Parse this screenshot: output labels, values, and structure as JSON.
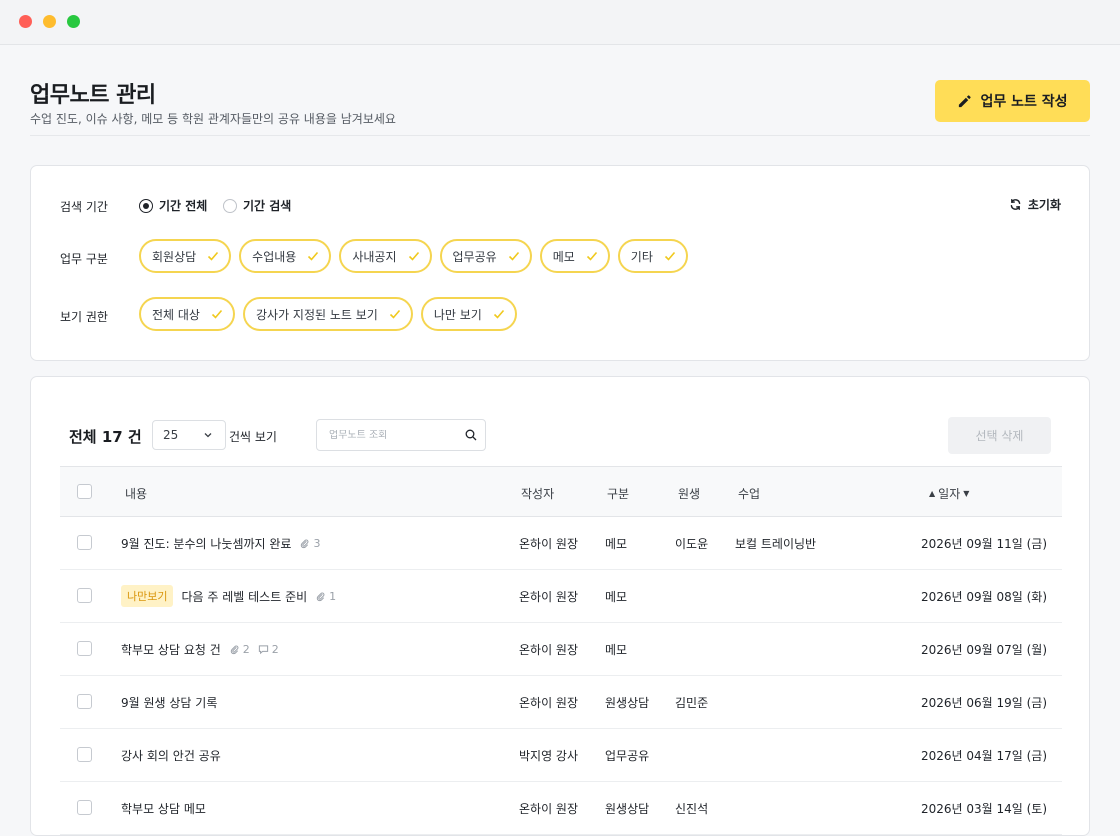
{
  "header": {
    "title": "업무노트 관리",
    "subtitle": "수업 진도, 이슈 사항, 메모 등 학원 관계자들만의 공유 내용을 남겨보세요",
    "write_button": "업무 노트 작성"
  },
  "filters": {
    "period_label": "검색 기간",
    "period_all": "기간 전체",
    "period_search": "기간 검색",
    "reset_label": "초기화",
    "category_label": "업무 구분",
    "categories": [
      "회원상담",
      "수업내용",
      "사내공지",
      "업무공유",
      "메모",
      "기타"
    ],
    "permission_label": "보기 권한",
    "permissions": [
      "전체 대상",
      "강사가 지정된 노트 보기",
      "나만 보기"
    ]
  },
  "list": {
    "total": "전체 17 건",
    "page_size": "25",
    "per_page_label": "건씩 보기",
    "search_placeholder": "업무노트 조회",
    "delete_button": "선택 삭제",
    "columns": {
      "content": "내용",
      "author": "작성자",
      "category": "구분",
      "student": "원생",
      "class": "수업",
      "date": "일자"
    },
    "rows": [
      {
        "tag": "",
        "title": "9월 진도: 분수의 나눗셈까지 완료",
        "attachments": "3",
        "comments": "",
        "author": "온하이 원장",
        "category": "메모",
        "student": "이도윤",
        "class": "보컬 트레이닝반",
        "date": "2026년 09월 11일 (금)"
      },
      {
        "tag": "나만보기",
        "title": "다음 주 레벨 테스트 준비",
        "attachments": "1",
        "comments": "",
        "author": "온하이 원장",
        "category": "메모",
        "student": "",
        "class": "",
        "date": "2026년 09월 08일 (화)"
      },
      {
        "tag": "",
        "title": "학부모 상담 요청 건",
        "attachments": "2",
        "comments": "2",
        "author": "온하이 원장",
        "category": "메모",
        "student": "",
        "class": "",
        "date": "2026년 09월 07일 (월)"
      },
      {
        "tag": "",
        "title": "9월 원생 상담 기록",
        "attachments": "",
        "comments": "",
        "author": "온하이 원장",
        "category": "원생상담",
        "student": "김민준",
        "class": "",
        "date": "2026년 06월 19일 (금)"
      },
      {
        "tag": "",
        "title": "강사 회의 안건 공유",
        "attachments": "",
        "comments": "",
        "author": "박지영 강사",
        "category": "업무공유",
        "student": "",
        "class": "",
        "date": "2026년 04월 17일 (금)"
      },
      {
        "tag": "",
        "title": "학부모 상담 메모",
        "attachments": "",
        "comments": "",
        "author": "온하이 원장",
        "category": "원생상담",
        "student": "신진석",
        "class": "",
        "date": "2026년 03월 14일 (토)"
      }
    ]
  },
  "colors": {
    "accent": "#ffdd57",
    "chip_border": "#f5d550",
    "tag_bg": "#fff2c6",
    "tag_text": "#d9950c"
  }
}
